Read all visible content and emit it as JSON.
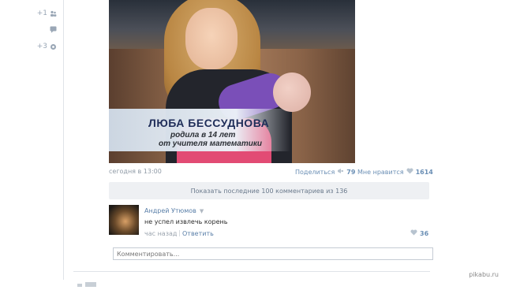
{
  "sidebar": {
    "likes_count": "+1",
    "shares_count": "+3"
  },
  "post": {
    "caption_name": "ЛЮБА БЕССУДНОВА",
    "caption_line1": "родила в 14 лет",
    "caption_line2": "от учителя математики",
    "date": "сегодня в 13:00",
    "share_label": "Поделиться",
    "share_count": "79",
    "like_label": "Мне нравится",
    "like_count": "1614"
  },
  "comments": {
    "show_more": "Показать последние 100 комментариев из 136",
    "items": [
      {
        "author": "Андрей Утюмов",
        "text": "не успел извлечь корень",
        "time": "час назад",
        "reply": "Ответить",
        "likes": "36"
      }
    ],
    "input_placeholder": "Комментировать..."
  },
  "watermark": "pikabu.ru",
  "colors": {
    "link": "#5a7fa8",
    "muted": "#8f9aa6",
    "panel": "#eef0f3"
  }
}
